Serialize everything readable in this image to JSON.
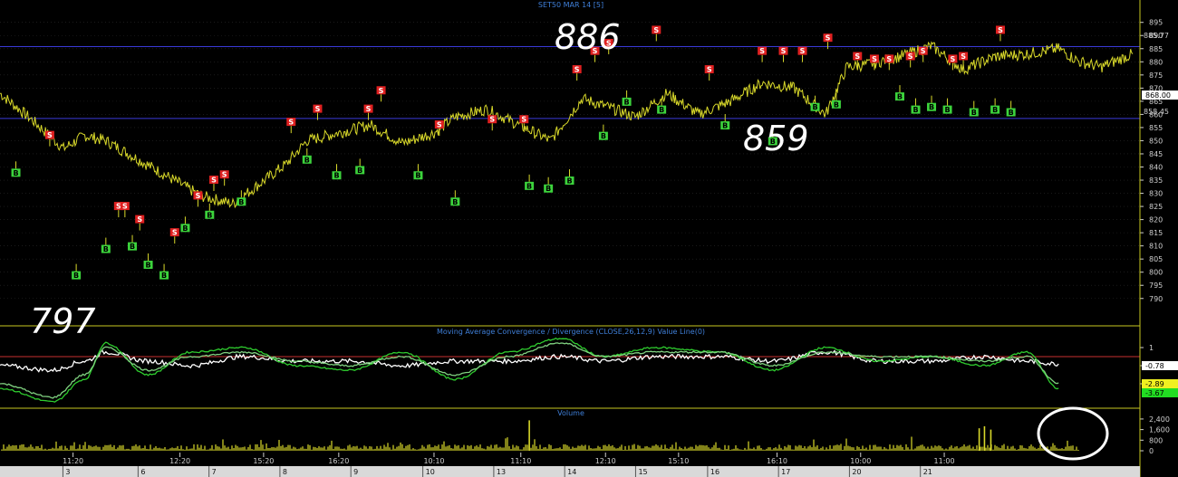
{
  "chart_data": [
    {
      "type": "line",
      "title": "SET50 MAR 14   [5]",
      "ylim": [
        782,
        898
      ],
      "y_ticks": [
        895,
        890,
        885,
        880,
        875,
        870,
        865,
        860,
        855,
        850,
        845,
        840,
        835,
        830,
        825,
        820,
        815,
        810,
        805,
        800,
        795,
        790
      ],
      "resistance_label": "885.77",
      "current_label": "868.00",
      "support_label": "858.45",
      "resistance_value": 885.77,
      "support_value": 858.45,
      "annotations": [
        "886",
        "859",
        "797"
      ],
      "series": [
        {
          "color": "#d8d82a",
          "x": [
            0,
            3,
            6,
            8,
            10,
            13,
            16,
            19,
            22,
            25,
            27,
            29,
            32,
            35,
            38,
            41,
            43,
            46,
            49,
            52,
            55,
            58,
            60,
            63,
            66,
            69,
            72,
            75,
            78,
            80,
            82,
            85,
            88,
            91,
            94,
            97,
            100,
            102,
            104,
            107
          ],
          "values": [
            868,
            858,
            847,
            852,
            850,
            843,
            836,
            829,
            826,
            835,
            841,
            850,
            853,
            856,
            849,
            853,
            859,
            862,
            856,
            850,
            866,
            862,
            859,
            868,
            860,
            865,
            872,
            870,
            860,
            878,
            879,
            882,
            886,
            877,
            882,
            883,
            885,
            880,
            878,
            883
          ]
        }
      ],
      "buy_signals": [
        {
          "x": 1.5,
          "y": 838
        },
        {
          "x": 7.2,
          "y": 799
        },
        {
          "x": 10.0,
          "y": 809
        },
        {
          "x": 12.5,
          "y": 810
        },
        {
          "x": 14.0,
          "y": 803
        },
        {
          "x": 15.5,
          "y": 799
        },
        {
          "x": 17.5,
          "y": 817
        },
        {
          "x": 19.8,
          "y": 822
        },
        {
          "x": 22.8,
          "y": 827
        },
        {
          "x": 29.0,
          "y": 843
        },
        {
          "x": 31.8,
          "y": 837
        },
        {
          "x": 34.0,
          "y": 839
        },
        {
          "x": 39.5,
          "y": 837
        },
        {
          "x": 43.0,
          "y": 827
        },
        {
          "x": 50.0,
          "y": 833
        },
        {
          "x": 51.8,
          "y": 832
        },
        {
          "x": 53.8,
          "y": 835
        },
        {
          "x": 57.0,
          "y": 852
        },
        {
          "x": 59.2,
          "y": 865
        },
        {
          "x": 62.5,
          "y": 862
        },
        {
          "x": 68.5,
          "y": 856
        },
        {
          "x": 73.0,
          "y": 850
        },
        {
          "x": 77.0,
          "y": 863
        },
        {
          "x": 79.0,
          "y": 864
        },
        {
          "x": 85.0,
          "y": 867
        },
        {
          "x": 86.5,
          "y": 862
        },
        {
          "x": 88.0,
          "y": 863
        },
        {
          "x": 89.5,
          "y": 862
        },
        {
          "x": 92.0,
          "y": 861
        },
        {
          "x": 94.0,
          "y": 862
        },
        {
          "x": 95.5,
          "y": 861
        }
      ],
      "sell_signals": [
        {
          "x": 4.7,
          "y": 852
        },
        {
          "x": 11.2,
          "y": 825
        },
        {
          "x": 11.8,
          "y": 825
        },
        {
          "x": 13.2,
          "y": 820
        },
        {
          "x": 16.5,
          "y": 815
        },
        {
          "x": 18.7,
          "y": 829
        },
        {
          "x": 20.2,
          "y": 835
        },
        {
          "x": 21.2,
          "y": 837
        },
        {
          "x": 27.5,
          "y": 857
        },
        {
          "x": 30.0,
          "y": 862
        },
        {
          "x": 34.8,
          "y": 862
        },
        {
          "x": 36.0,
          "y": 869
        },
        {
          "x": 41.5,
          "y": 856
        },
        {
          "x": 46.5,
          "y": 858
        },
        {
          "x": 49.5,
          "y": 858
        },
        {
          "x": 54.5,
          "y": 877
        },
        {
          "x": 56.2,
          "y": 884
        },
        {
          "x": 57.5,
          "y": 887
        },
        {
          "x": 62.0,
          "y": 892
        },
        {
          "x": 67.0,
          "y": 877
        },
        {
          "x": 72.0,
          "y": 884
        },
        {
          "x": 74.0,
          "y": 884
        },
        {
          "x": 75.8,
          "y": 884
        },
        {
          "x": 78.2,
          "y": 889
        },
        {
          "x": 81.0,
          "y": 882
        },
        {
          "x": 82.6,
          "y": 881
        },
        {
          "x": 84.0,
          "y": 881
        },
        {
          "x": 86.0,
          "y": 882
        },
        {
          "x": 87.2,
          "y": 884
        },
        {
          "x": 90.0,
          "y": 881
        },
        {
          "x": 91.0,
          "y": 882
        },
        {
          "x": 94.5,
          "y": 892
        }
      ]
    },
    {
      "type": "line",
      "title": "Moving Average Convergence / Divergence (CLOSE,26,12,9) Value Line(0)",
      "y_ticks": [
        "1",
        "-1",
        "-3"
      ],
      "current_labels": [
        "-0.78",
        "-2.89",
        "-3.67"
      ],
      "series": [
        {
          "color": "#ffffff",
          "x": [
            0,
            5,
            8,
            10,
            14,
            18,
            23,
            28,
            33,
            38,
            43,
            48,
            53,
            57,
            62,
            68,
            73,
            78,
            83,
            88,
            93,
            97,
            100
          ],
          "values": [
            -1.0,
            -1.5,
            -0.5,
            0.5,
            -0.5,
            -1.0,
            0.0,
            -0.5,
            -0.5,
            -1.0,
            -0.5,
            -0.5,
            0.0,
            -0.5,
            0.0,
            0.0,
            -0.5,
            0.5,
            -0.5,
            -0.5,
            0.0,
            -0.5,
            -0.8
          ]
        },
        {
          "color": "#2ecc2e",
          "x": [
            0,
            5,
            8,
            10,
            14,
            18,
            23,
            28,
            33,
            38,
            43,
            48,
            53,
            57,
            62,
            68,
            73,
            78,
            83,
            88,
            93,
            97,
            100
          ],
          "values": [
            -3.5,
            -5.0,
            -2.5,
            1.5,
            -2.0,
            0.5,
            1.0,
            -1.0,
            -1.5,
            0.5,
            -2.5,
            0.5,
            2.0,
            0.0,
            1.0,
            0.5,
            -1.5,
            1.0,
            -0.5,
            0.0,
            -1.0,
            0.5,
            -3.5
          ]
        },
        {
          "color": "#7fd07f",
          "x": [
            0,
            5,
            8,
            10,
            14,
            18,
            23,
            28,
            33,
            38,
            43,
            48,
            53,
            57,
            62,
            68,
            73,
            78,
            83,
            88,
            93,
            97,
            100
          ],
          "values": [
            -3.0,
            -4.5,
            -2.0,
            1.0,
            -1.5,
            0.0,
            0.5,
            -0.5,
            -1.0,
            0.0,
            -2.0,
            0.0,
            1.5,
            0.0,
            0.5,
            0.5,
            -1.0,
            0.5,
            0.0,
            0.0,
            -0.5,
            0.0,
            -2.9
          ]
        }
      ]
    },
    {
      "type": "bar",
      "title": "Volume",
      "y_ticks": [
        "2,400",
        "1,600",
        "800",
        "0"
      ],
      "ylim": [
        0,
        2600
      ],
      "spikes": [
        {
          "x": 50.0,
          "value": 2300
        },
        {
          "x": 92.5,
          "value": 1700
        },
        {
          "x": 93.0,
          "value": 1850
        },
        {
          "x": 93.6,
          "value": 1600
        }
      ],
      "typical_value": 350
    }
  ],
  "x_axis": {
    "time_labels": [
      {
        "x": 6.9,
        "label": "11:20"
      },
      {
        "x": 17.0,
        "label": "12:20"
      },
      {
        "x": 24.9,
        "label": "15:20"
      },
      {
        "x": 32.0,
        "label": "16:20"
      },
      {
        "x": 41.0,
        "label": "10:10"
      },
      {
        "x": 49.2,
        "label": "11:10"
      },
      {
        "x": 57.2,
        "label": "12:10"
      },
      {
        "x": 64.1,
        "label": "15:10"
      },
      {
        "x": 73.4,
        "label": "16:10"
      },
      {
        "x": 81.3,
        "label": "10:00"
      },
      {
        "x": 89.2,
        "label": "11:00"
      }
    ],
    "date_labels": [
      {
        "x": 6.2,
        "label": "3"
      },
      {
        "x": 13.3,
        "label": "6"
      },
      {
        "x": 20.0,
        "label": "7"
      },
      {
        "x": 26.7,
        "label": "8"
      },
      {
        "x": 33.4,
        "label": "9"
      },
      {
        "x": 40.2,
        "label": "10"
      },
      {
        "x": 46.9,
        "label": "13"
      },
      {
        "x": 53.6,
        "label": "14"
      },
      {
        "x": 60.3,
        "label": "15"
      },
      {
        "x": 67.1,
        "label": "16"
      },
      {
        "x": 73.8,
        "label": "17"
      },
      {
        "x": 80.5,
        "label": "20"
      },
      {
        "x": 87.2,
        "label": "21"
      }
    ]
  },
  "signal_labels": {
    "buy": "B",
    "sell": "S"
  },
  "colors": {
    "background": "#000000",
    "price": "#d8d82a",
    "grid": "#2a2a2a",
    "hline": "#3a3ad8",
    "separator": "#c8c820",
    "macd_zero": "#c83030",
    "buy": "#3cd43c",
    "sell": "#e02020",
    "axis_text": "#cfcfcf",
    "title": "#3f7fd8",
    "date_bar": "#d9d9d9",
    "circle": "#ffffff"
  }
}
